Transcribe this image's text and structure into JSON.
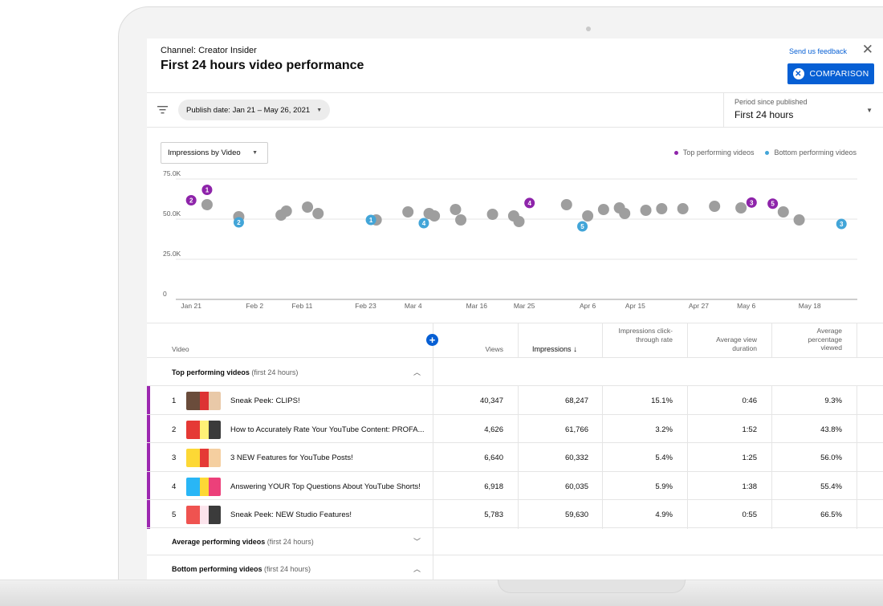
{
  "header": {
    "channel": "Channel: Creator Insider",
    "title": "First 24 hours video performance",
    "feedback_link": "Send us feedback",
    "close_icon": "close-icon",
    "comparison_button": "COMPARISON"
  },
  "filters": {
    "date_chip": "Publish date: Jan 21 – May 26, 2021",
    "period_label": "Period since published",
    "period_value": "First 24 hours"
  },
  "chart_controls": {
    "metric_select": "Impressions by Video"
  },
  "legend": {
    "top": "Top performing videos",
    "bottom": "Bottom performing videos"
  },
  "colors": {
    "top": "#8e24aa",
    "bottom": "#42a5d8",
    "average": "#9e9e9e",
    "accent": "#065fd4"
  },
  "chart_data": {
    "type": "scatter",
    "ylim": [
      0,
      75000
    ],
    "y_ticks": [
      "0",
      "25.0K",
      "50.0K",
      "75.0K"
    ],
    "y_tick_values": [
      0,
      25000,
      50000,
      75000
    ],
    "x_tick_labels": [
      "Jan 21",
      "Feb 2",
      "Feb 11",
      "Feb 23",
      "Mar 4",
      "Mar 16",
      "Mar 25",
      "Apr 6",
      "Apr 15",
      "Apr 27",
      "May 6",
      "May 18"
    ],
    "x_tick_dates": [
      "2021-01-21",
      "2021-02-02",
      "2021-02-11",
      "2021-02-23",
      "2021-03-04",
      "2021-03-16",
      "2021-03-25",
      "2021-04-06",
      "2021-04-15",
      "2021-04-27",
      "2021-05-06",
      "2021-05-18"
    ],
    "xlim": [
      "2021-01-19",
      "2021-05-27"
    ],
    "series": [
      {
        "name": "Top performing videos",
        "color": "#8e24aa",
        "points": [
          {
            "x": "2021-01-24",
            "y": 68247,
            "label": "1"
          },
          {
            "x": "2021-01-21",
            "y": 61766,
            "label": "2"
          },
          {
            "x": "2021-05-07",
            "y": 60332,
            "label": "3"
          },
          {
            "x": "2021-03-26",
            "y": 60035,
            "label": "4"
          },
          {
            "x": "2021-05-11",
            "y": 59630,
            "label": "5"
          }
        ]
      },
      {
        "name": "",
        "color": "#9e9e9e",
        "points": [
          {
            "x": "2021-01-24",
            "y": 59000
          },
          {
            "x": "2021-01-30",
            "y": 51500
          },
          {
            "x": "2021-02-07",
            "y": 52500
          },
          {
            "x": "2021-02-08",
            "y": 55000
          },
          {
            "x": "2021-02-12",
            "y": 57500
          },
          {
            "x": "2021-02-14",
            "y": 53500
          },
          {
            "x": "2021-02-25",
            "y": 49500
          },
          {
            "x": "2021-03-03",
            "y": 54500
          },
          {
            "x": "2021-03-07",
            "y": 53500
          },
          {
            "x": "2021-03-08",
            "y": 52000
          },
          {
            "x": "2021-03-12",
            "y": 56000
          },
          {
            "x": "2021-03-13",
            "y": 49500
          },
          {
            "x": "2021-03-19",
            "y": 53000
          },
          {
            "x": "2021-03-23",
            "y": 52000
          },
          {
            "x": "2021-03-24",
            "y": 48500
          },
          {
            "x": "2021-04-02",
            "y": 59000
          },
          {
            "x": "2021-04-06",
            "y": 52000
          },
          {
            "x": "2021-04-09",
            "y": 56000
          },
          {
            "x": "2021-04-12",
            "y": 57000
          },
          {
            "x": "2021-04-13",
            "y": 53500
          },
          {
            "x": "2021-04-17",
            "y": 55500
          },
          {
            "x": "2021-04-20",
            "y": 56500
          },
          {
            "x": "2021-04-24",
            "y": 56500
          },
          {
            "x": "2021-04-30",
            "y": 58000
          },
          {
            "x": "2021-05-05",
            "y": 57000
          },
          {
            "x": "2021-05-13",
            "y": 54500
          },
          {
            "x": "2021-05-16",
            "y": 49500
          }
        ]
      },
      {
        "name": "Bottom performing videos",
        "color": "#42a5d8",
        "points": [
          {
            "x": "2021-05-24",
            "y": 47000,
            "label": "3"
          },
          {
            "x": "2021-02-24",
            "y": 49500,
            "label": "1"
          },
          {
            "x": "2021-01-30",
            "y": 48000,
            "label": "2"
          },
          {
            "x": "2021-03-06",
            "y": 47500,
            "label": "4"
          },
          {
            "x": "2021-04-05",
            "y": 45500,
            "label": "5"
          }
        ]
      }
    ]
  },
  "table": {
    "columns": [
      "Video",
      "Views",
      "Impressions",
      "Impressions click-through rate",
      "Average view duration",
      "Average percentage viewed"
    ],
    "sort_icon": "arrow-down-icon",
    "groups": {
      "top": {
        "label": "Top performing videos",
        "sub": "(first 24 hours)"
      },
      "average": {
        "label": "Average performing videos",
        "sub": "(first 24 hours)"
      },
      "bottom": {
        "label": "Bottom performing videos",
        "sub": "(first 24 hours)"
      }
    },
    "rows": [
      {
        "rank": "1",
        "title": "Sneak Peek: CLIPS!",
        "views": "40,347",
        "impressions": "68,247",
        "ctr": "15.1%",
        "avd": "0:46",
        "apv": "9.3%"
      },
      {
        "rank": "2",
        "title": "How to Accurately Rate Your YouTube Content: PROFA...",
        "views": "4,626",
        "impressions": "61,766",
        "ctr": "3.2%",
        "avd": "1:52",
        "apv": "43.8%"
      },
      {
        "rank": "3",
        "title": "3 NEW Features for YouTube Posts!",
        "views": "6,640",
        "impressions": "60,332",
        "ctr": "5.4%",
        "avd": "1:25",
        "apv": "56.0%"
      },
      {
        "rank": "4",
        "title": "Answering YOUR Top Questions About YouTube Shorts!",
        "views": "6,918",
        "impressions": "60,035",
        "ctr": "5.9%",
        "avd": "1:38",
        "apv": "55.4%"
      },
      {
        "rank": "5",
        "title": "Sneak Peek: NEW Studio Features!",
        "views": "5,783",
        "impressions": "59,630",
        "ctr": "4.9%",
        "avd": "0:55",
        "apv": "66.5%"
      }
    ]
  }
}
